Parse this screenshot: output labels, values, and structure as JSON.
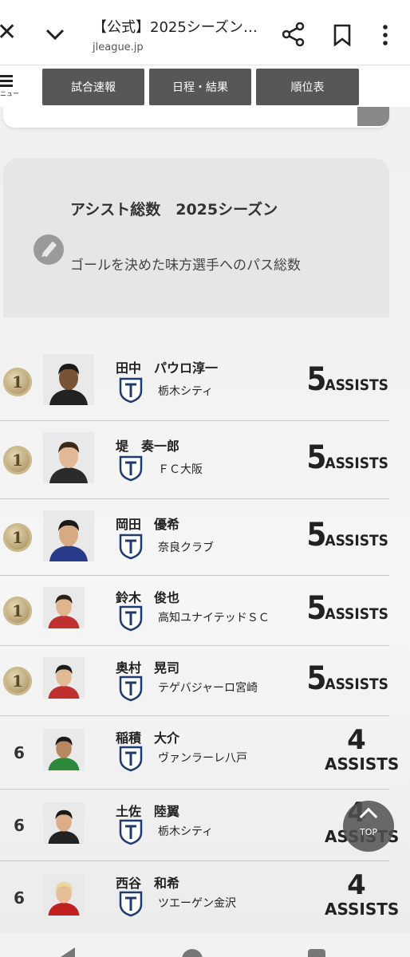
{
  "browser": {
    "close_icon": "close-icon",
    "title": "【公式】2025シーズン…",
    "domain": "jleague.jp"
  },
  "site_nav": {
    "menu_label": "ニュー",
    "tabs": [
      {
        "label": "試合速報"
      },
      {
        "label": "日程・結果"
      },
      {
        "label": "順位表"
      }
    ]
  },
  "info": {
    "heading": "アシスト総数　2025シーズン",
    "description": "ゴールを決めた味方選手へのパス総数"
  },
  "ranking": [
    {
      "rank": "1",
      "name": "田中　パウロ淳一",
      "club": "栃木シティ",
      "assists": "5",
      "unit": "ASSISTS"
    },
    {
      "rank": "1",
      "name": "堤　奏一郎",
      "club": "ＦＣ大阪",
      "assists": "5",
      "unit": "ASSISTS"
    },
    {
      "rank": "1",
      "name": "岡田　優希",
      "club": "奈良クラブ",
      "assists": "5",
      "unit": "ASSISTS"
    },
    {
      "rank": "1",
      "name": "鈴木　俊也",
      "club": "高知ユナイテッドＳＣ",
      "assists": "5",
      "unit": "ASSISTS"
    },
    {
      "rank": "1",
      "name": "奥村　晃司",
      "club": "テゲバジャーロ宮崎",
      "assists": "5",
      "unit": "ASSISTS"
    },
    {
      "rank": "6",
      "name": "稲積　大介",
      "club": "ヴァンラーレ八戸",
      "assists": "4",
      "unit": "ASSISTS"
    },
    {
      "rank": "6",
      "name": "土佐　陸翼",
      "club": "栃木シティ",
      "assists": "4",
      "unit": "ASSISTS"
    },
    {
      "rank": "6",
      "name": "西谷　和希",
      "club": "ツエーゲン金沢",
      "assists": "4",
      "unit": "ASSISTS"
    }
  ],
  "top_button": {
    "label": "TOP"
  },
  "colors": {
    "nav_tab_bg": "#585656",
    "medal_gold": "#b09a6a"
  }
}
